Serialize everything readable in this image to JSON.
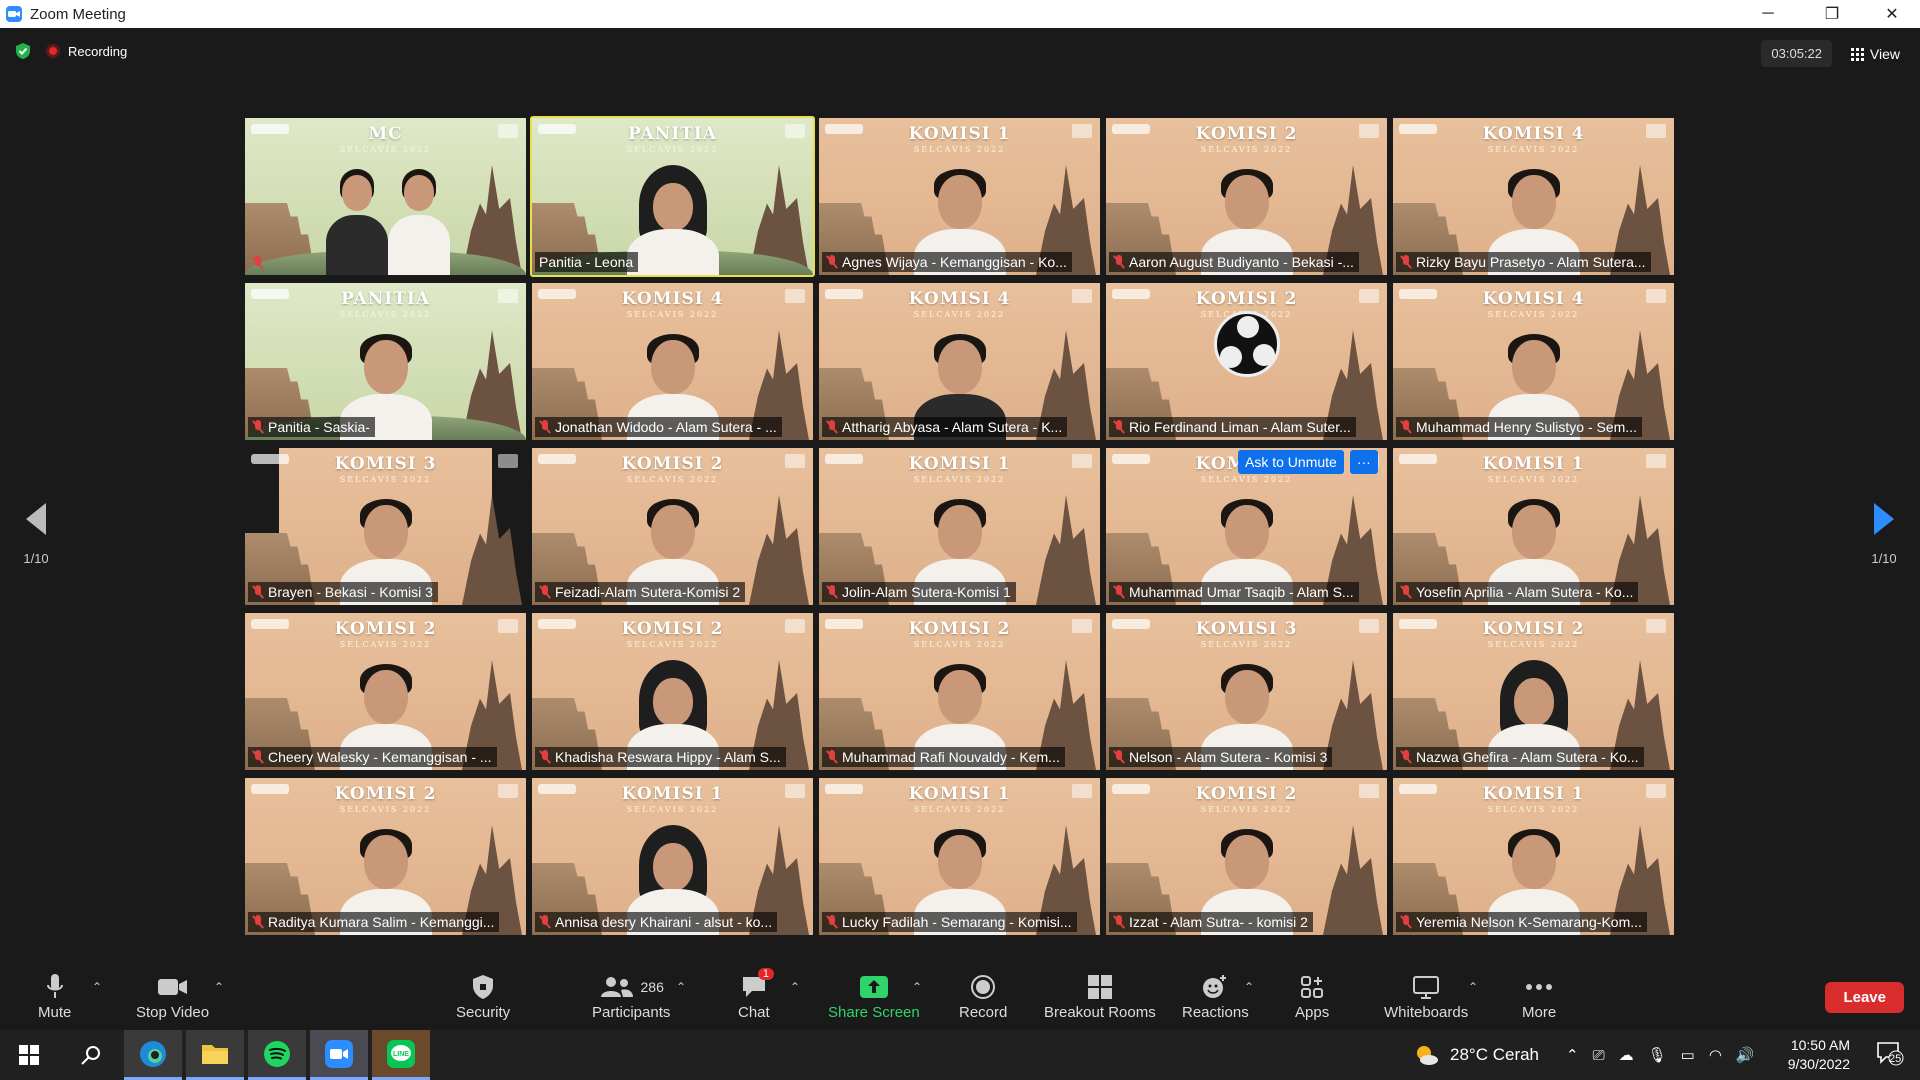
{
  "window": {
    "title": "Zoom Meeting"
  },
  "meeting": {
    "recording_label": "Recording",
    "timer": "03:05:22",
    "view_label": "View",
    "page_left": "1/10",
    "page_right": "1/10",
    "ask_unmute_label": "Ask to Unmute",
    "more_dots": "···"
  },
  "tiles": [
    {
      "badge": "MC",
      "sub": "SELCAVIS 2022",
      "name": ""
    },
    {
      "badge": "PANITIA",
      "sub": "SELCAVIS 2022",
      "name": "Panitia - Leona"
    },
    {
      "badge": "KOMISI 1",
      "sub": "SELCAVIS 2022",
      "name": "Agnes Wijaya - Kemanggisan - Ko..."
    },
    {
      "badge": "KOMISI 2",
      "sub": "SELCAVIS 2022",
      "name": "Aaron August Budiyanto - Bekasi -..."
    },
    {
      "badge": "KOMISI 4",
      "sub": "SELCAVIS 2022",
      "name": "Rizky Bayu Prasetyo - Alam Sutera..."
    },
    {
      "badge": "PANITIA",
      "sub": "SELCAVIS 2022",
      "name": "Panitia - Saskia-"
    },
    {
      "badge": "KOMISI 4",
      "sub": "SELCAVIS 2022",
      "name": "Jonathan Widodo - Alam Sutera - ..."
    },
    {
      "badge": "KOMISI 4",
      "sub": "SELCAVIS 2022",
      "name": "Attharig Abyasa - Alam Sutera - K..."
    },
    {
      "badge": "KOMISI 2",
      "sub": "SELCAVIS 2022",
      "name": "Rio Ferdinand Liman - Alam Suter..."
    },
    {
      "badge": "KOMISI 4",
      "sub": "SELCAVIS 2022",
      "name": "Muhammad Henry Sulistyo - Sem..."
    },
    {
      "badge": "KOMISI 3",
      "sub": "SELCAVIS 2022",
      "name": "Brayen - Bekasi - Komisi 3"
    },
    {
      "badge": "KOMISI 2",
      "sub": "SELCAVIS 2022",
      "name": "Feizadi-Alam Sutera-Komisi 2"
    },
    {
      "badge": "KOMISI 1",
      "sub": "SELCAVIS 2022",
      "name": "Jolin-Alam Sutera-Komisi 1"
    },
    {
      "badge": "KOMISI 3",
      "sub": "SELCAVIS 2022",
      "name": "Muhammad Umar Tsaqib - Alam S..."
    },
    {
      "badge": "KOMISI 1",
      "sub": "SELCAVIS 2022",
      "name": "Yosefin Aprilia - Alam Sutera - Ko..."
    },
    {
      "badge": "KOMISI 2",
      "sub": "SELCAVIS 2022",
      "name": "Cheery Walesky - Kemanggisan - ..."
    },
    {
      "badge": "KOMISI 2",
      "sub": "SELCAVIS 2022",
      "name": "Khadisha Reswara Hippy - Alam S..."
    },
    {
      "badge": "KOMISI 2",
      "sub": "SELCAVIS 2022",
      "name": "Muhammad Rafi Nouvaldy - Kem..."
    },
    {
      "badge": "KOMISI 3",
      "sub": "SELCAVIS 2022",
      "name": "Nelson - Alam Sutera - Komisi 3"
    },
    {
      "badge": "KOMISI 2",
      "sub": "SELCAVIS 2022",
      "name": "Nazwa Ghefira - Alam Sutera - Ko..."
    },
    {
      "badge": "KOMISI 2",
      "sub": "SELCAVIS 2022",
      "name": "Raditya Kumara Salim - Kemanggi..."
    },
    {
      "badge": "KOMISI 1",
      "sub": "SELCAVIS 2022",
      "name": "Annisa desry Khairani - alsut - ko..."
    },
    {
      "badge": "KOMISI 1",
      "sub": "SELCAVIS 2022",
      "name": "Lucky Fadilah - Semarang - Komisi..."
    },
    {
      "badge": "KOMISI 2",
      "sub": "SELCAVIS 2022",
      "name": "Izzat - Alam Sutra- - komisi 2"
    },
    {
      "badge": "KOMISI 1",
      "sub": "SELCAVIS 2022",
      "name": "Yeremia Nelson K-Semarang-Kom..."
    }
  ],
  "toolbar": {
    "mute": "Mute",
    "stop_video": "Stop Video",
    "security": "Security",
    "participants": "Participants",
    "participants_count": "286",
    "chat": "Chat",
    "chat_badge": "1",
    "share_screen": "Share Screen",
    "record": "Record",
    "breakout_rooms": "Breakout Rooms",
    "reactions": "Reactions",
    "apps": "Apps",
    "whiteboards": "Whiteboards",
    "more": "More",
    "leave": "Leave"
  },
  "taskbar": {
    "weather": "28°C Cerah",
    "time": "10:50 AM",
    "date": "9/30/2022",
    "notifications": "25"
  },
  "colors": {
    "accent": "#0e71eb",
    "leave": "#d92c2c",
    "share": "#30d36b",
    "tile_bg": "#e2b894"
  }
}
